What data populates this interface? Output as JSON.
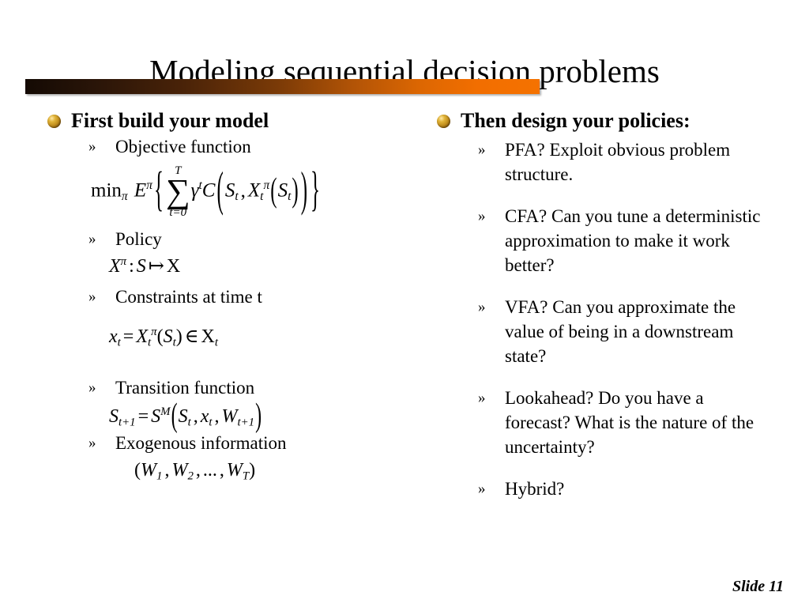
{
  "slide": {
    "title": "Modeling sequential decision problems",
    "slide_number_label": "Slide 11",
    "accent_color_dark": "#140a04",
    "accent_color_bright": "#f57200",
    "bullet_color": "#c08d1d"
  },
  "left_column": {
    "heading": "First build your model",
    "items": [
      {
        "label": "Objective function"
      },
      {
        "label": "Policy"
      },
      {
        "label": "Constraints at time t"
      },
      {
        "label": "Transition function"
      },
      {
        "label": "Exogenous information"
      }
    ],
    "equations": {
      "objective": {
        "plain": "min_pi E^pi { sum_{t=0}^{T} gamma^t C( S_t , X_t^pi ( S_t ) ) }",
        "min": "min",
        "pi_sub": "π",
        "expectation": "E",
        "pi_sup": "π",
        "brace_open": "{",
        "sum_symbol": "∑",
        "sum_upper": "T",
        "sum_lower": "t=0",
        "gamma": "γ",
        "gamma_exp": "t",
        "cost": "C",
        "state": "S",
        "state_sub": "t",
        "comma": ",",
        "policy_X": "X",
        "policy_sub": "t",
        "policy_sup": "π",
        "brace_close": "}"
      },
      "policy": {
        "plain": "X^pi : S |-> X",
        "X": "X",
        "pi_sup": "π",
        "colon": ":",
        "S": "S",
        "mapsto": "↦",
        "set_X": "X"
      },
      "constraint": {
        "plain": "x_t = X_t^pi ( S_t ) in X_t",
        "x": "x",
        "x_sub": "t",
        "equals": "=",
        "X": "X",
        "X_sub": "t",
        "X_sup": "π",
        "S": "S",
        "S_sub": "t",
        "element_of": "∈",
        "set_X": "X",
        "set_X_sub": "t"
      },
      "transition": {
        "plain": "S_{t+1} = S^M ( S_t , x_t , W_{t+1} )",
        "S": "S",
        "S_sub": "t+1",
        "equals": "=",
        "SM": "S",
        "SM_sup": "M",
        "arg_S": "S",
        "arg_S_sub": "t",
        "arg_x": "x",
        "arg_x_sub": "t",
        "arg_W": "W",
        "arg_W_sub": "t+1",
        "comma": ","
      },
      "exogenous": {
        "plain": "( W_1 , W_2 , ... , W_T )",
        "W": "W",
        "sub1": "1",
        "sub2": "2",
        "ellipsis": "...",
        "subT": "T",
        "comma": ","
      }
    }
  },
  "right_column": {
    "heading": "Then design your policies:",
    "items": [
      {
        "label": "PFA? Exploit obvious problem structure."
      },
      {
        "label": "CFA? Can you tune a deterministic approximation to make it work better?"
      },
      {
        "label": "VFA? Can you approximate the value of being in a downstream state?"
      },
      {
        "label": "Lookahead?  Do you have a forecast?  What is the nature of the uncertainty?"
      },
      {
        "label": "Hybrid?"
      }
    ]
  },
  "icons": {
    "sphere_bullet": "sphere-bullet-icon",
    "guillemet": "»"
  }
}
